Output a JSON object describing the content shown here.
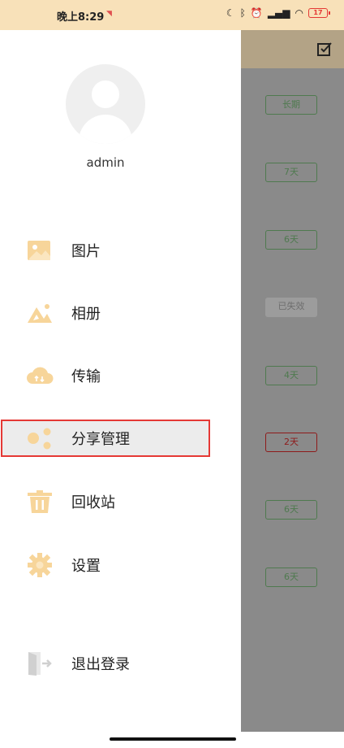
{
  "status_bar": {
    "time": "晚上8:29",
    "battery": "17",
    "icons": [
      "moon-icon",
      "bluetooth-icon",
      "alarm-icon",
      "signal-icon",
      "wifi-icon",
      "battery-icon"
    ]
  },
  "drawer": {
    "username": "admin",
    "menu": [
      {
        "label": "图片",
        "icon": "image-icon"
      },
      {
        "label": "相册",
        "icon": "album-icon"
      },
      {
        "label": "传输",
        "icon": "cloud-icon"
      },
      {
        "label": "分享管理",
        "icon": "share-icon",
        "selected": true
      },
      {
        "label": "回收站",
        "icon": "trash-icon"
      },
      {
        "label": "设置",
        "icon": "gear-icon"
      },
      {
        "label": "退出登录",
        "icon": "logout-icon"
      }
    ]
  },
  "background_list": {
    "badges": [
      "长期",
      "7天",
      "6天",
      "已失效",
      "4天",
      "2天",
      "6天",
      "6天"
    ]
  },
  "colors": {
    "status_bar": "#f8e1b9",
    "icon_accent": "#f7d59a",
    "selection_border": "#e53935",
    "badge_green": "#4f7a4f",
    "badge_red": "#8e1a1a"
  }
}
